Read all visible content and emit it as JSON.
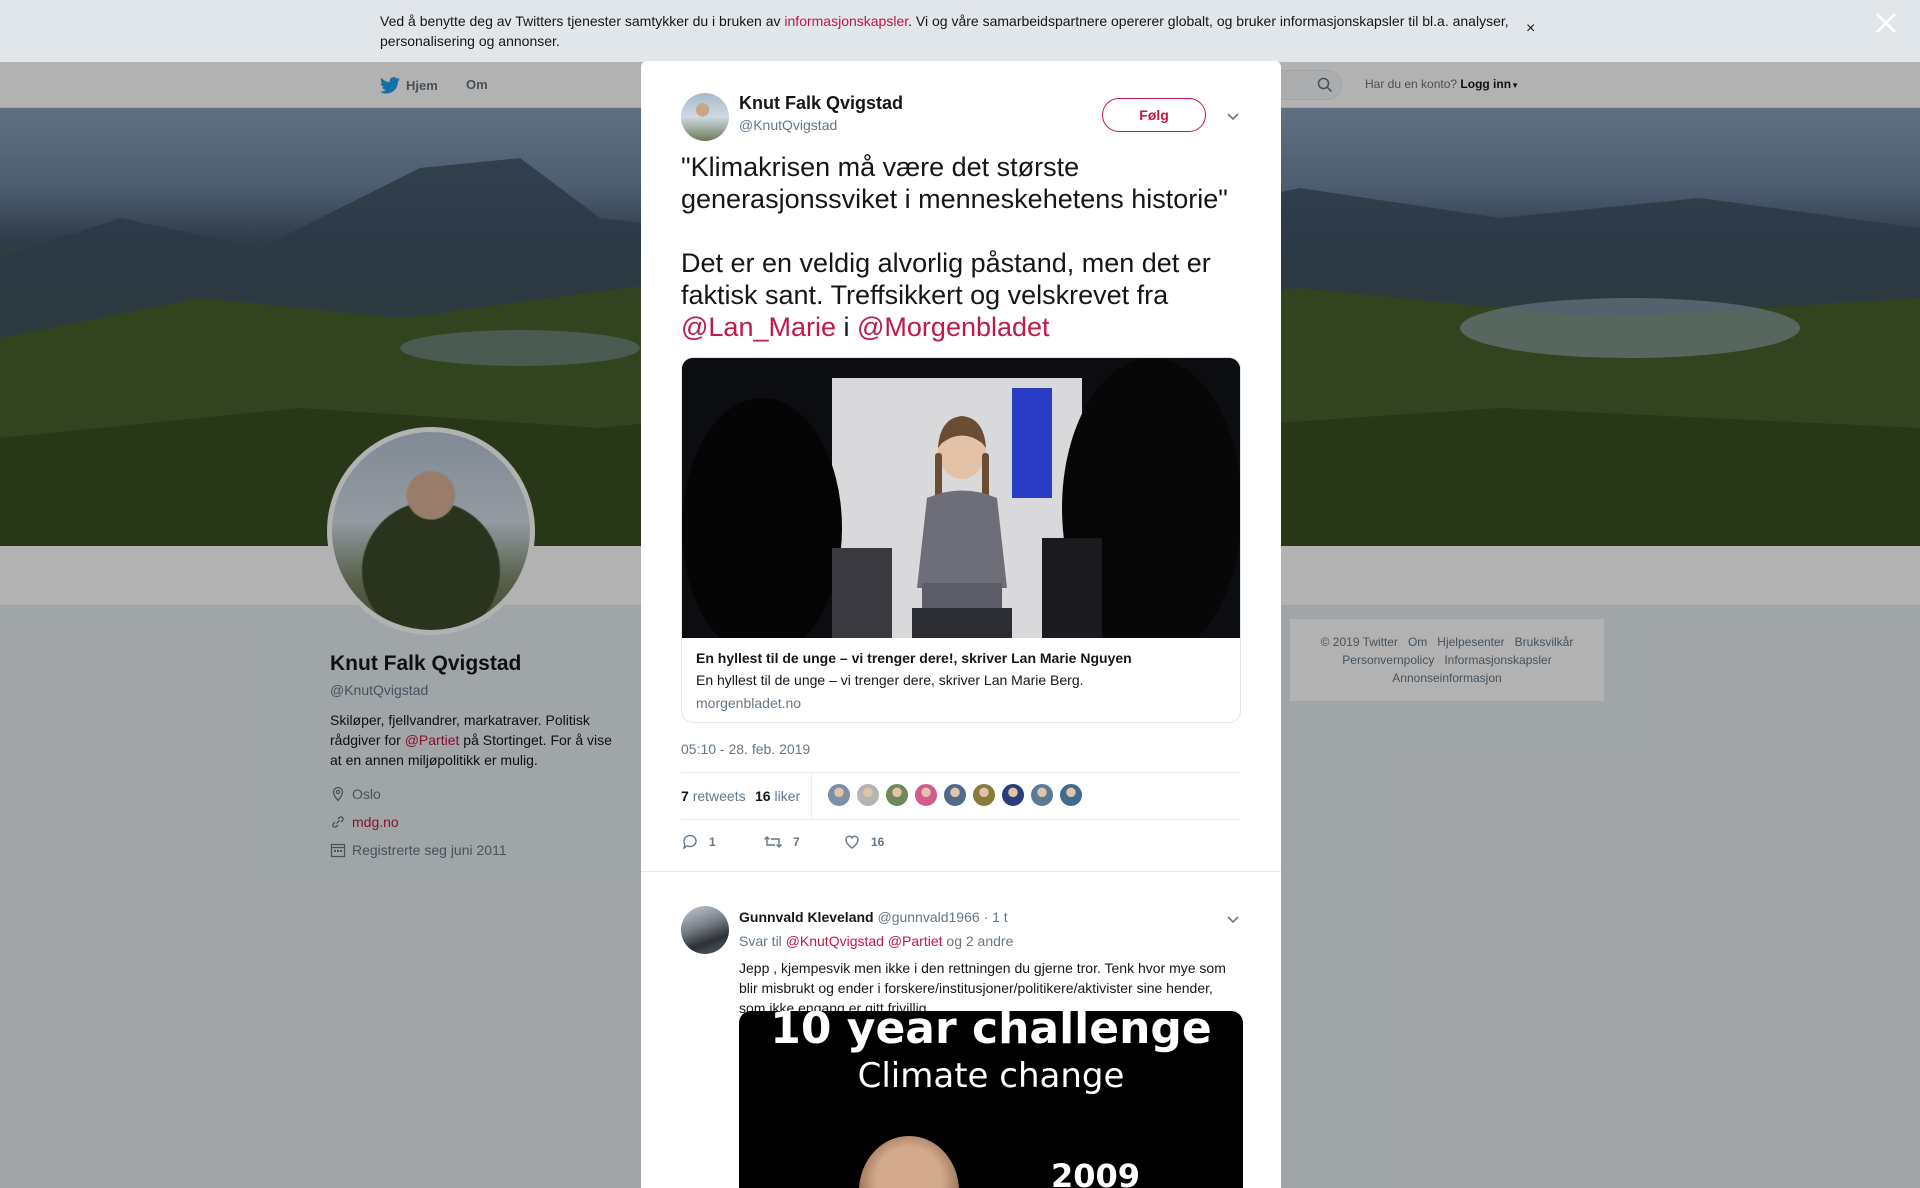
{
  "cookie_banner": {
    "text_before": "Ved å benytte deg av Twitters tjenester samtykker du i bruken av ",
    "link": "informasjonskapsler",
    "text_after": ". Vi og våre samarbeidspartnere opererer globalt, og bruker informasjonskapsler til bl.a. analyser, personalisering og annonser.",
    "close": "×"
  },
  "topnav": {
    "home": "Hjem",
    "about": "Om",
    "login_prompt": "Har du en konto?",
    "login": "Logg inn"
  },
  "profile": {
    "name": "Knut Falk Qvigstad",
    "handle": "@KnutQvigstad",
    "bio_before": "Skiløper, fjellvandrer, markatraver. Politisk rådgiver for ",
    "bio_mention": "@Partiet",
    "bio_after": " på Stortinget. For å vise at en annen miljøpolitikk er mulig.",
    "location": "Oslo",
    "website": "mdg.no",
    "joined": "Registrerte seg juni 2011"
  },
  "footer": {
    "links": [
      "© 2019 Twitter",
      "Om",
      "Hjelpesenter",
      "Bruksvilkår",
      "Personvernpolicy",
      "Informasjonskapsler",
      "Annonseinformasjon"
    ]
  },
  "tweet": {
    "author_name": "Knut Falk Qvigstad",
    "author_handle": "@KnutQvigstad",
    "follow_label": "Følg",
    "text_line1": "\"Klimakrisen må være det største generasjonssviket i menneskehetens historie\"",
    "text_line2": "Det er en veldig alvorlig påstand, men det er faktisk sant. Treffsikkert og velskrevet fra ",
    "mention1": "@Lan_Marie",
    "conj": " i ",
    "mention2": "@Morgenbladet",
    "card": {
      "title": "En hyllest til de unge – vi trenger dere!, skriver Lan Marie Nguyen",
      "description": "En hyllest til de unge – vi trenger dere, skriver Lan Marie Berg.",
      "domain": "morgenbladet.no"
    },
    "timestamp": "05:10 - 28. feb. 2019",
    "retweets_count": "7",
    "retweets_label": "retweets",
    "likes_count": "16",
    "likes_label": "liker",
    "liker_colors": [
      "#7b8fa8",
      "#b4b4b4",
      "#6e8a5a",
      "#d25a8f",
      "#4f6b8c",
      "#8a7a3a",
      "#2c3e7a",
      "#5a7a9a",
      "#3e6b8f"
    ],
    "reply_count": "1",
    "retweet_count_action": "7",
    "like_count_action": "16"
  },
  "reply": {
    "name": "Gunnvald Kleveland",
    "handle": "@gunnvald1966",
    "time": "· 1 t",
    "reply_to_label": "Svar til",
    "reply_to_mention1": "@KnutQvigstad",
    "reply_to_mention2": "@Partiet",
    "reply_to_others": "og 2 andre",
    "text": "Jepp , kjempesvik men ikke i den rettningen du gjerne tror. Tenk hvor mye som blir misbrukt og ender i forskere/institusjoner/politikere/aktivister sine hender, som ikke engang er gitt frivillig.",
    "media_title": "10 year challenge",
    "media_subtitle": "Climate change",
    "media_year": "2009"
  },
  "colors": {
    "accent": "#c01944",
    "twitter_blue": "#1da1f2",
    "muted": "#657786"
  }
}
